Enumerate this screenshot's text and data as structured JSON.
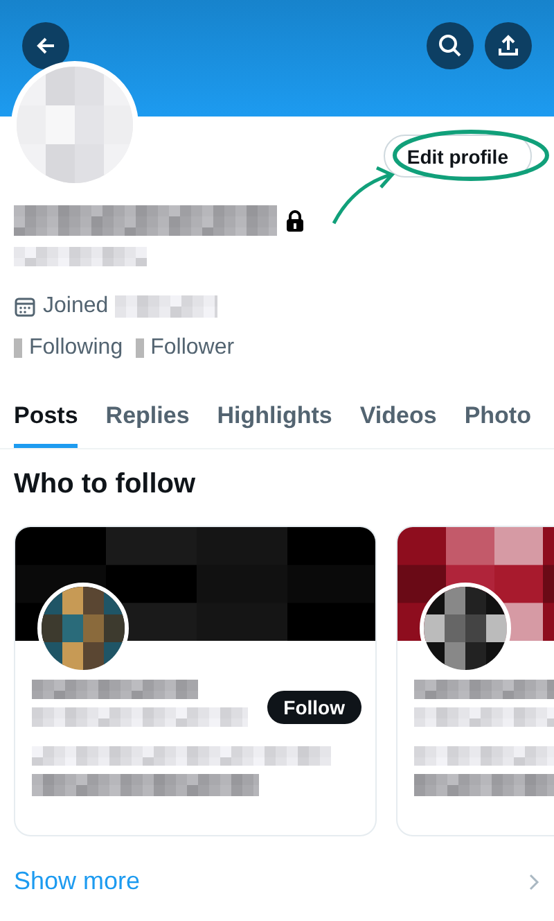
{
  "profile": {
    "edit_button": "Edit profile",
    "joined_label": "Joined",
    "following_label": "Following",
    "follower_label": "Follower"
  },
  "tabs": [
    {
      "label": "Posts",
      "selected": true
    },
    {
      "label": "Replies",
      "selected": false
    },
    {
      "label": "Highlights",
      "selected": false
    },
    {
      "label": "Videos",
      "selected": false
    },
    {
      "label": "Photo",
      "selected": false
    }
  ],
  "who_to_follow": {
    "title": "Who to follow",
    "follow_button": "Follow",
    "show_more": "Show more"
  }
}
